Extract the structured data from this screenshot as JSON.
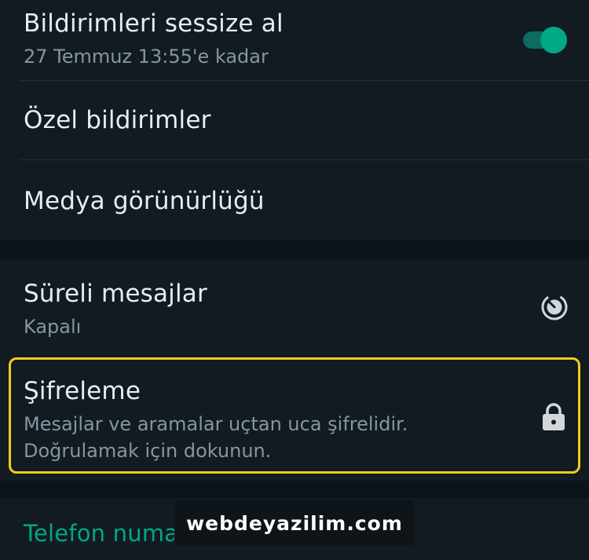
{
  "mute": {
    "title": "Bildirimleri sessize al",
    "subtitle": "27 Temmuz 13:55'e kadar",
    "enabled": true
  },
  "custom_notifications": {
    "title": "Özel bildirimler"
  },
  "media_visibility": {
    "title": "Medya görünürlüğü"
  },
  "disappearing": {
    "title": "Süreli mesajlar",
    "subtitle": "Kapalı",
    "icon": "timer-icon"
  },
  "encryption": {
    "title": "Şifreleme",
    "line1": "Mesajlar ve aramalar uçtan uca şifrelidir.",
    "line2": "Doğrulamak için dokunun.",
    "icon": "lock-icon"
  },
  "phone": {
    "label": "Telefon numarası"
  },
  "watermark": "webdeyazilim.com",
  "colors": {
    "accent": "#00a884",
    "highlight": "#f5cc1a",
    "background": "#121b22"
  }
}
